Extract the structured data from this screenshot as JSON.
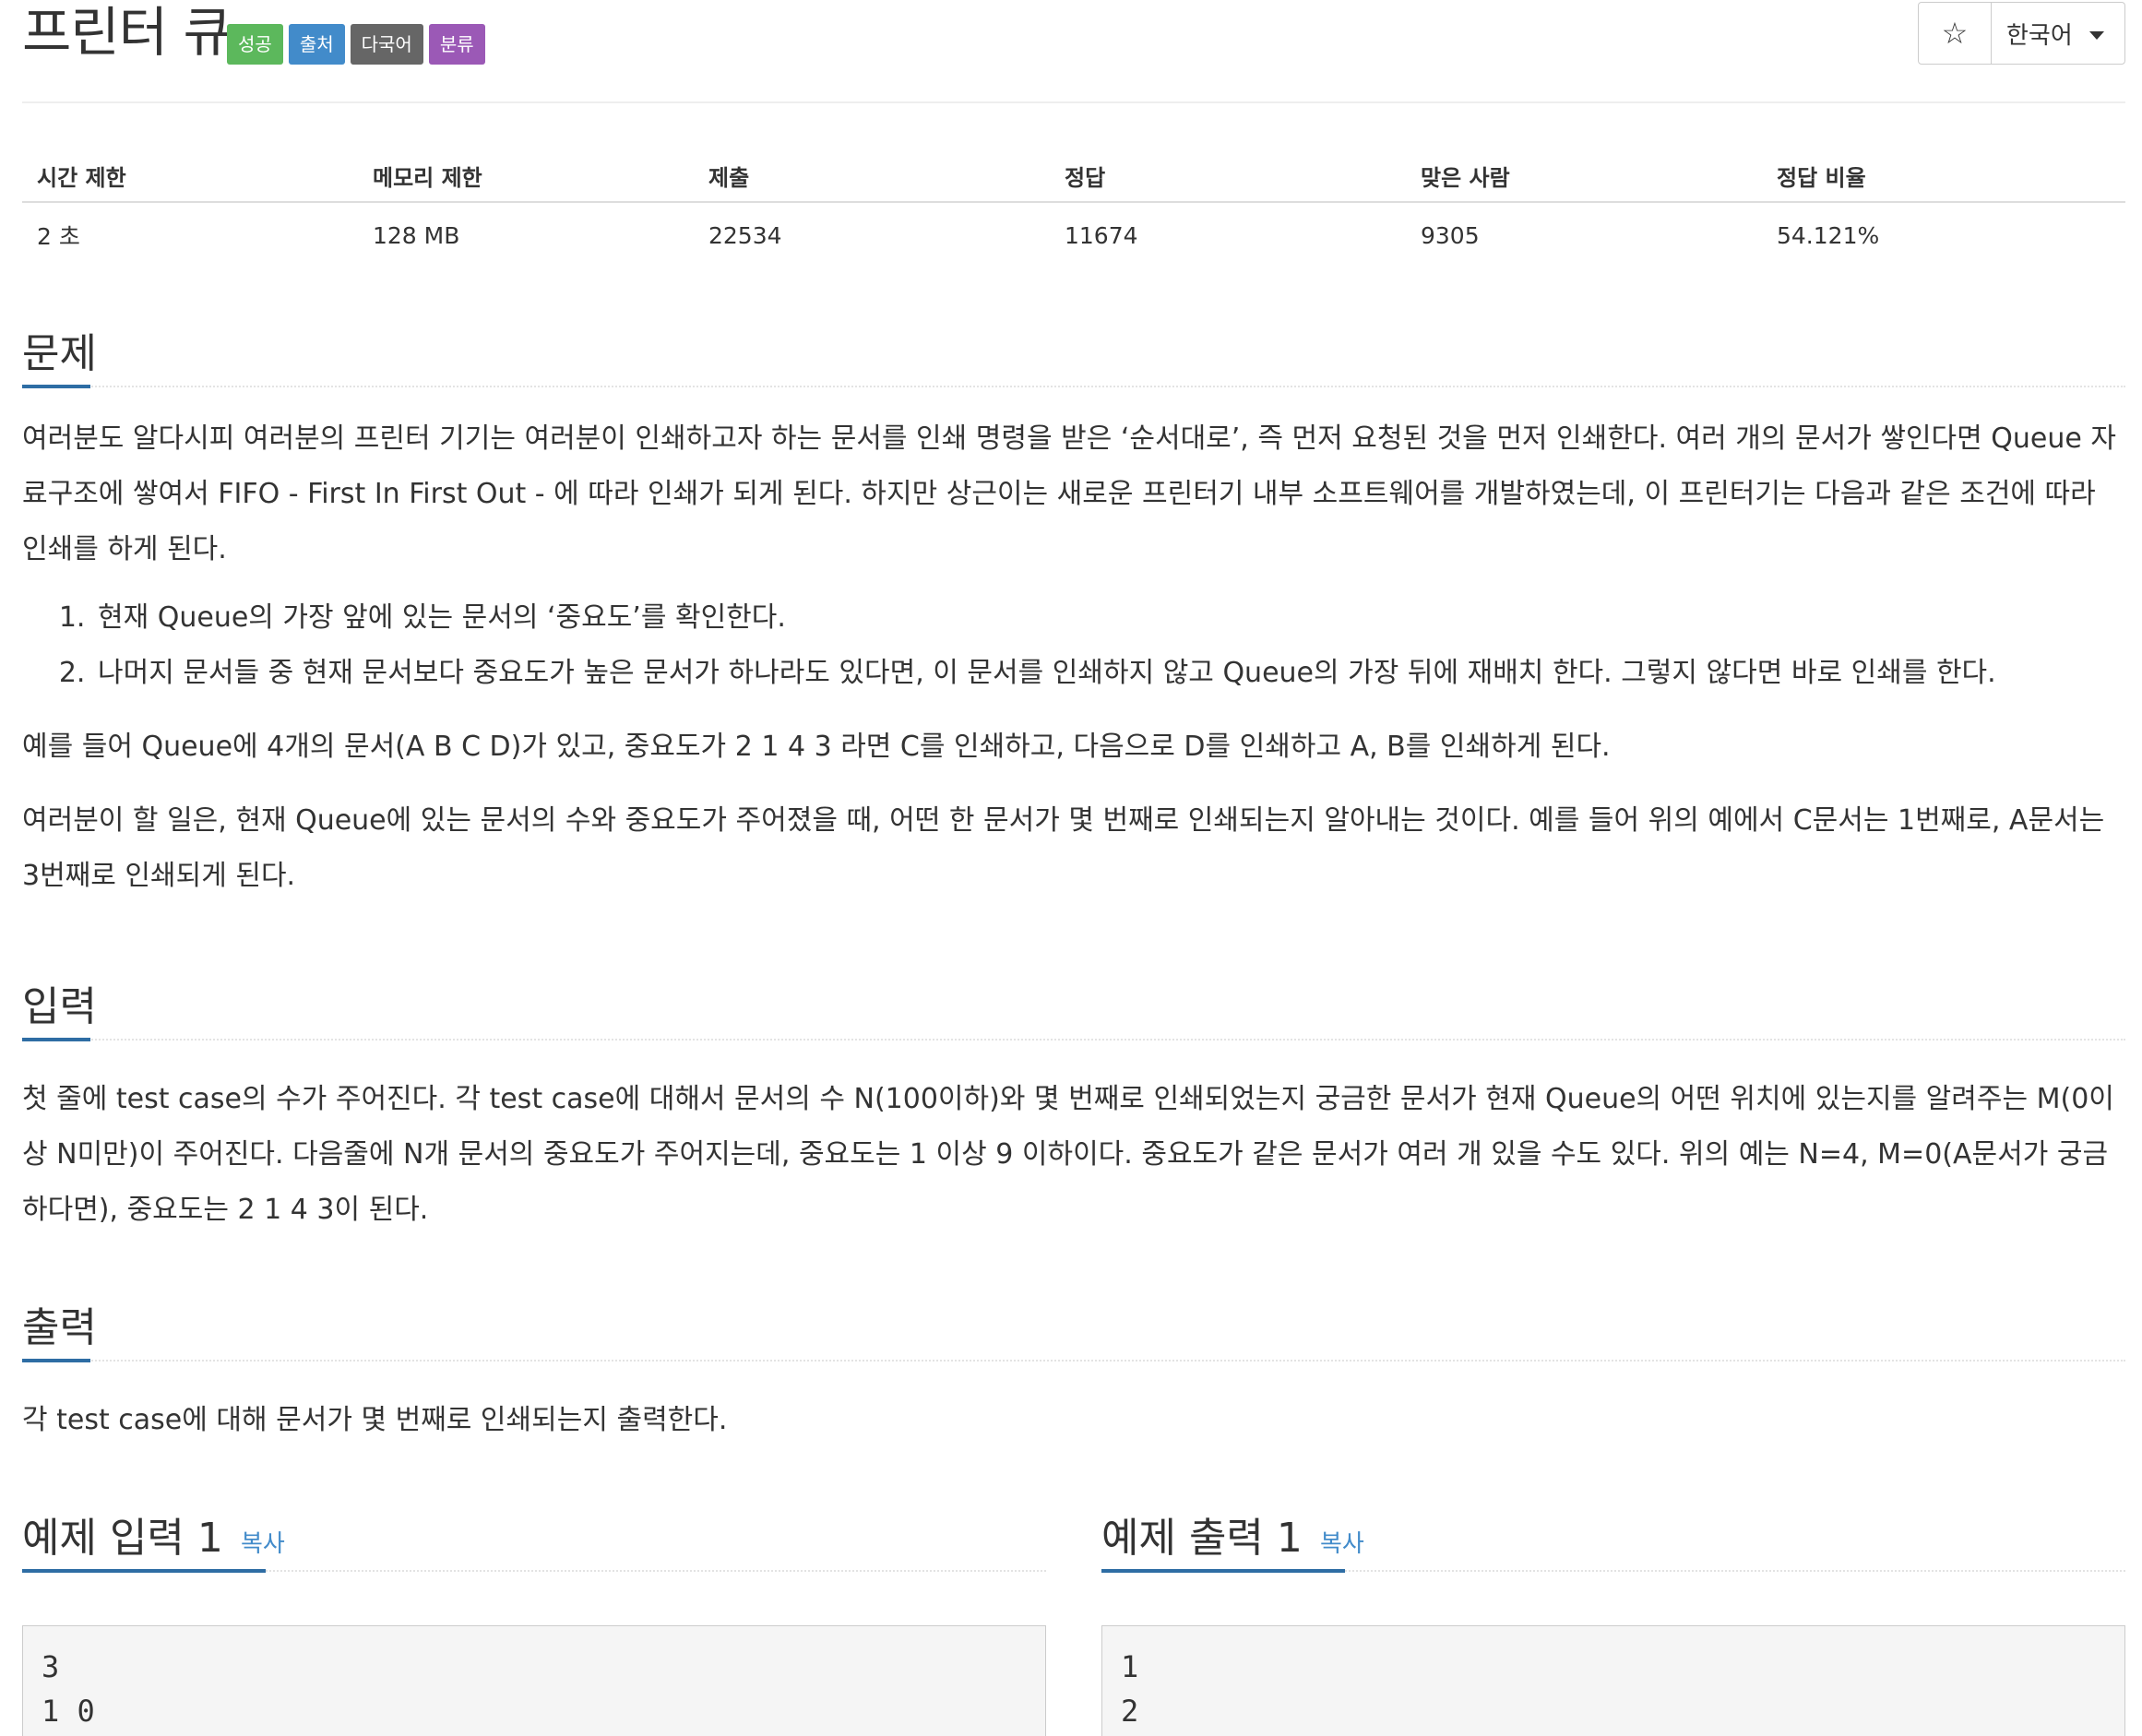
{
  "problem": {
    "title": "프린터 큐",
    "badges": [
      "성공",
      "출처",
      "다국어",
      "분류"
    ],
    "tools": {
      "star_icon": "☆",
      "language": "한국어"
    }
  },
  "info_table": {
    "headers": [
      "시간 제한",
      "메모리 제한",
      "제출",
      "정답",
      "맞은 사람",
      "정답 비율"
    ],
    "values": [
      "2 초",
      "128 MB",
      "22534",
      "11674",
      "9305",
      "54.121%"
    ]
  },
  "sections": {
    "problem": {
      "heading": "문제",
      "p1": "여러분도 알다시피 여러분의 프린터 기기는 여러분이 인쇄하고자 하는 문서를 인쇄 명령을 받은 ‘순서대로’, 즉 먼저 요청된 것을 먼저 인쇄한다. 여러 개의 문서가 쌓인다면 Queue 자료구조에 쌓여서 FIFO - First In First Out - 에 따라 인쇄가 되게 된다. 하지만 상근이는 새로운 프린터기 내부 소프트웨어를 개발하였는데, 이 프린터기는 다음과 같은 조건에 따라 인쇄를 하게 된다.",
      "steps": [
        "현재 Queue의 가장 앞에 있는 문서의 ‘중요도’를 확인한다.",
        "나머지 문서들 중 현재 문서보다 중요도가 높은 문서가 하나라도 있다면, 이 문서를 인쇄하지 않고 Queue의 가장 뒤에 재배치 한다. 그렇지 않다면 바로 인쇄를 한다."
      ],
      "p2": "예를 들어 Queue에 4개의 문서(A B C D)가 있고, 중요도가 2 1 4 3 라면 C를 인쇄하고, 다음으로 D를 인쇄하고 A, B를 인쇄하게 된다.",
      "p3": "여러분이 할 일은, 현재 Queue에 있는 문서의 수와 중요도가 주어졌을 때, 어떤 한 문서가 몇 번째로 인쇄되는지 알아내는 것이다. 예를 들어 위의 예에서 C문서는 1번째로, A문서는 3번째로 인쇄되게 된다."
    },
    "input": {
      "heading": "입력",
      "p1": "첫 줄에 test case의 수가 주어진다. 각 test case에 대해서 문서의 수 N(100이하)와 몇 번째로 인쇄되었는지 궁금한 문서가 현재 Queue의 어떤 위치에 있는지를 알려주는 M(0이상 N미만)이 주어진다. 다음줄에 N개 문서의 중요도가 주어지는데, 중요도는 1 이상 9 이하이다. 중요도가 같은 문서가 여러 개 있을 수도 있다. 위의 예는 N=4, M=0(A문서가 궁금하다면), 중요도는 2 1 4 3이 된다."
    },
    "output": {
      "heading": "출력",
      "p1": "각 test case에 대해 문서가 몇 번째로 인쇄되는지 출력한다."
    }
  },
  "samples": {
    "input": {
      "heading": "예제 입력 1",
      "copy": "복사",
      "lines": [
        "3",
        "1 0"
      ]
    },
    "output": {
      "heading": "예제 출력 1",
      "copy": "복사",
      "lines": [
        "1",
        "2"
      ]
    }
  }
}
